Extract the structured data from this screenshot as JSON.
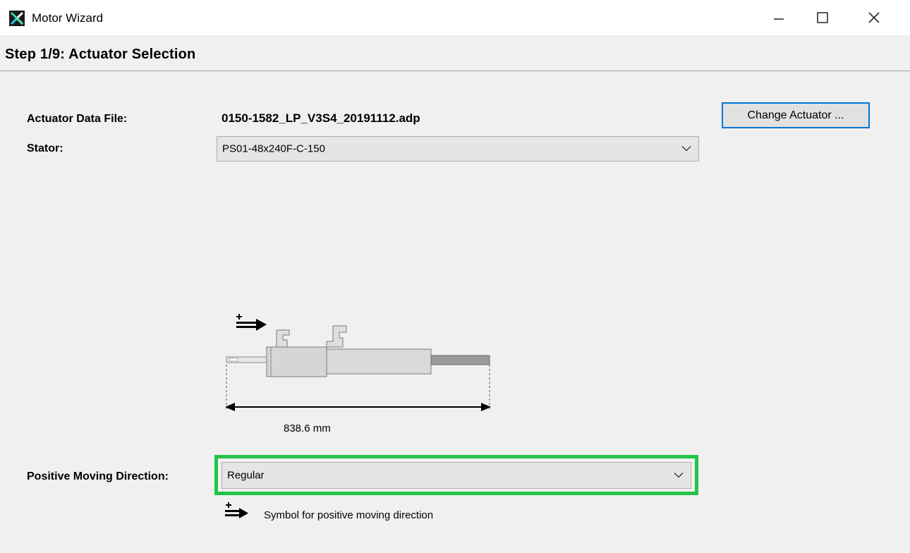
{
  "window": {
    "title": "Motor Wizard",
    "icon": "motor-wizard-app-icon",
    "controls": {
      "minimize_icon": "minimize-icon",
      "maximize_icon": "maximize-icon",
      "close_icon": "close-icon"
    }
  },
  "step": {
    "title": "Step 1/9: Actuator Selection"
  },
  "actuator": {
    "data_file_label": "Actuator Data File:",
    "data_file_value": "0150-1582_LP_V3S4_20191112.adp",
    "change_button_label": "Change Actuator ...",
    "stator_label": "Stator:",
    "stator_value": "PS01-48x240F-C-150"
  },
  "diagram": {
    "length_label": "838.6 mm"
  },
  "direction": {
    "label": "Positive Moving Direction:",
    "value": "Regular",
    "legend_text": "Symbol for positive moving direction"
  },
  "colors": {
    "highlight": "#22c44a",
    "focus_border": "#0078d7",
    "background": "#f0f0f0"
  }
}
